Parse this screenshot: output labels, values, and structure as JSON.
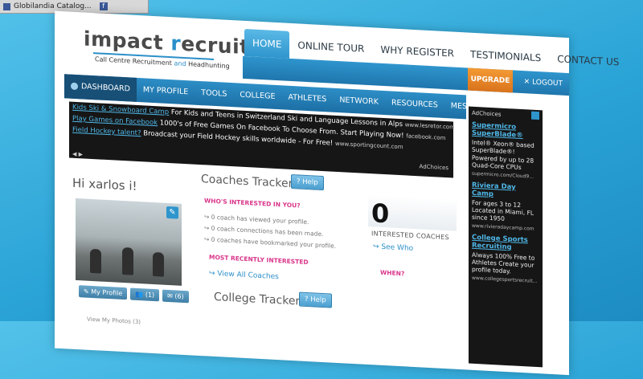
{
  "browser": {
    "tab_title": "Globilandia Catalog..."
  },
  "logo": {
    "word1": "impact ",
    "r_letter": "r",
    "word2": "ecruit",
    "tag_a": "Call Centre Recruitment ",
    "tag_and": "and",
    "tag_b": " Headhunting"
  },
  "top_nav": {
    "items": [
      "HOME",
      "ONLINE TOUR",
      "WHY REGISTER",
      "TESTIMONIALS",
      "CONTACT US"
    ]
  },
  "account_bar": {
    "upgrade": "UPGRADE",
    "logout": "LOGOUT",
    "logout_icon": "✕"
  },
  "sub_nav": {
    "items": [
      "DASHBOARD",
      "MY PROFILE",
      "TOOLS",
      "COLLEGE",
      "ATHLETES",
      "NETWORK",
      "RESOURCES",
      "MESSAGES"
    ]
  },
  "ad_strip": {
    "ads": [
      {
        "link": "Kids Ski & Snowboard Camp",
        "text": "For Kids and Teens in Switzerland Ski and Language Lessons in Alps",
        "url": "www.lesretor.com"
      },
      {
        "link": "Play Games on Facebook",
        "text": "1000's of Free Games On Facebook To Choose From. Start Playing Now!",
        "url": "facebook.com"
      },
      {
        "link": "Field Hockey talent?",
        "text": "Broadcast your Field Hockey skills worldwide - For Free!",
        "url": "www.sportingcount.com"
      }
    ],
    "adchoices": "AdChoices"
  },
  "profile": {
    "greeting": "Hi xarlos i!",
    "my_profile": "My Profile",
    "people_count": "(1)",
    "mail_count": "(6)",
    "my_photos": "View My Photos (3)"
  },
  "coaches_tracker": {
    "title": "Coaches Tracker",
    "help": "Help",
    "whos_interested": "WHO'S INTERESTED IN YOU?",
    "stats": [
      "0 coach has viewed your profile.",
      "0 coach connections has been made.",
      "0 coaches have bookmarked your profile."
    ],
    "most_recent": "MOST RECENTLY INTERESTED",
    "view_all": "View All Coaches",
    "interested_count": "0",
    "interested_label": "INTERESTED COACHES",
    "see_who": "See Who",
    "when": "WHEN?"
  },
  "college_tracker": {
    "title": "College Tracker",
    "help": "Help"
  },
  "side_ads": {
    "adchoices": "AdChoices",
    "ads": [
      {
        "title": "Supermicro SuperBlade®",
        "body": "Intel® Xeon® based SuperBlade®! Powered by up to 28 Quad-Core CPUs",
        "url": "supermicro.com/Cloud9..."
      },
      {
        "title": "Riviera Day Camp",
        "body": "For ages 3 to 12 Located in Miami, FL since 1950",
        "url": "www.rivieradaycamp.com"
      },
      {
        "title": "College Sports Recruiting",
        "body": "Always 100% Free to Athletes Create your profile today.",
        "url": "www.collegesportsrecruit..."
      }
    ]
  },
  "colors": {
    "brand_blue": "#2b8fc9",
    "upgrade_orange": "#e8862a",
    "accent_pink": "#d9358a"
  }
}
